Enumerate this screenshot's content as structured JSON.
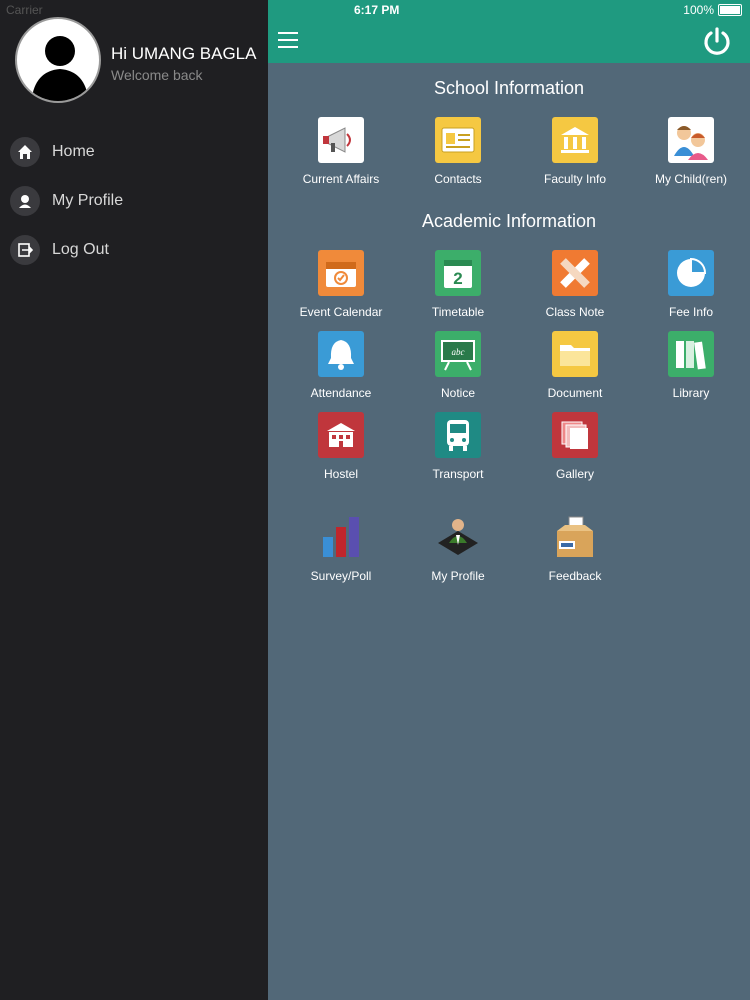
{
  "status_bar": {
    "carrier": "Carrier",
    "time": "6:17 PM",
    "battery": "100%"
  },
  "sidebar": {
    "greeting": "Hi UMANG BAGLA",
    "welcome": "Welcome back",
    "items": [
      {
        "label": "Home",
        "icon": "home-icon"
      },
      {
        "label": "My Profile",
        "icon": "user-icon"
      },
      {
        "label": "Log Out",
        "icon": "logout-icon"
      }
    ]
  },
  "main": {
    "school_title": "School Information",
    "academic_title": "Academic Information",
    "school_tiles": [
      {
        "label": "Current Affairs",
        "icon": "megaphone-icon",
        "color": "#ffffff"
      },
      {
        "label": "Contacts",
        "icon": "contact-card-icon",
        "color": "#f5c842"
      },
      {
        "label": "Faculty Info",
        "icon": "building-icon",
        "color": "#f5c842"
      },
      {
        "label": "My Child(ren)",
        "icon": "children-icon",
        "color": "#ffffff"
      }
    ],
    "academic_tiles": [
      {
        "label": "Event Calendar",
        "icon": "calendar-icon",
        "color": "#f08a3a"
      },
      {
        "label": "Timetable",
        "icon": "timetable-icon",
        "color": "#3cae6a"
      },
      {
        "label": "Class Note",
        "icon": "pencil-ruler-icon",
        "color": "#f07a32"
      },
      {
        "label": "Fee Info",
        "icon": "pie-chart-icon",
        "color": "#3a9bd6"
      },
      {
        "label": "Attendance",
        "icon": "bell-icon",
        "color": "#3a9bd6"
      },
      {
        "label": "Notice",
        "icon": "chalkboard-icon",
        "color": "#3cae6a"
      },
      {
        "label": "Document",
        "icon": "folder-icon",
        "color": "#f5c842"
      },
      {
        "label": "Library",
        "icon": "books-icon",
        "color": "#3cae6a"
      },
      {
        "label": "Hostel",
        "icon": "hostel-icon",
        "color": "#c0363c"
      },
      {
        "label": "Transport",
        "icon": "bus-icon",
        "color": "#1f8a84"
      },
      {
        "label": "Gallery",
        "icon": "gallery-icon",
        "color": "#c0363c"
      }
    ],
    "extra_tiles": [
      {
        "label": "Survey/Poll",
        "icon": "bar-chart-icon"
      },
      {
        "label": "My Profile",
        "icon": "profile-person-icon"
      },
      {
        "label": "Feedback",
        "icon": "ballot-box-icon"
      }
    ]
  }
}
